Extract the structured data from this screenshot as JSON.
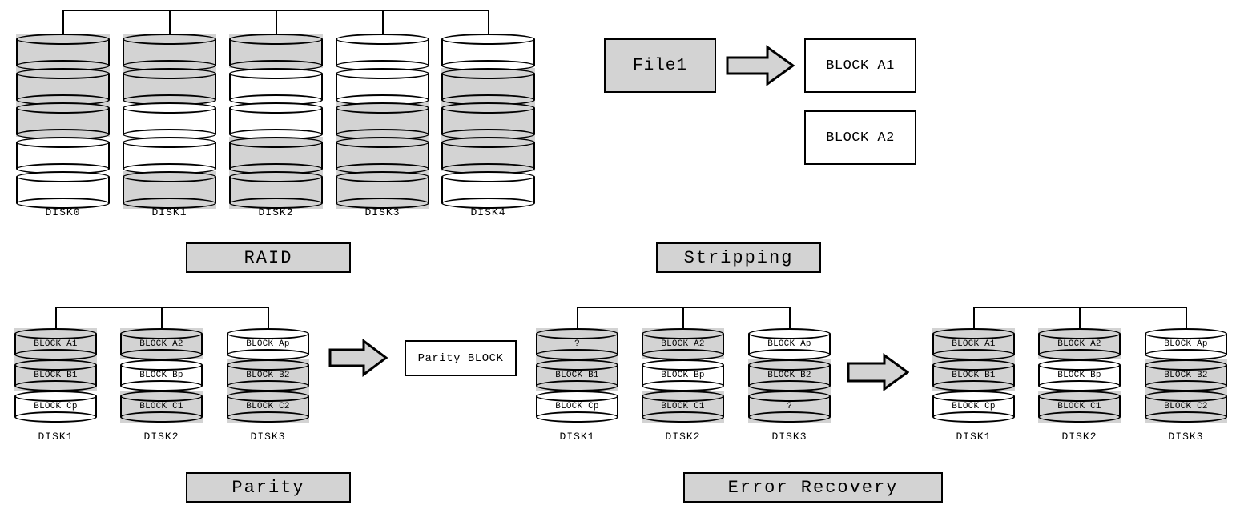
{
  "sections": {
    "raid": {
      "title": "RAID",
      "disks": [
        {
          "caption": "DISK0",
          "platters": [
            "gray",
            "gray",
            "gray",
            "white",
            "white"
          ]
        },
        {
          "caption": "DISK1",
          "platters": [
            "gray",
            "gray",
            "white",
            "white",
            "gray"
          ]
        },
        {
          "caption": "DISK2",
          "platters": [
            "gray",
            "white",
            "white",
            "gray",
            "gray"
          ]
        },
        {
          "caption": "DISK3",
          "platters": [
            "white",
            "white",
            "gray",
            "gray",
            "gray"
          ]
        },
        {
          "caption": "DISK4",
          "platters": [
            "white",
            "gray",
            "gray",
            "gray",
            "white"
          ]
        }
      ]
    },
    "stripping": {
      "title": "Stripping",
      "file_label": "File1",
      "blocks": [
        "BLOCK A1",
        "BLOCK A2"
      ]
    },
    "parity": {
      "title": "Parity",
      "disks": [
        {
          "caption": "DISK1",
          "blocks": [
            {
              "label": "BLOCK A1",
              "fill": "gray"
            },
            {
              "label": "BLOCK B1",
              "fill": "gray"
            },
            {
              "label": "BLOCK Cp",
              "fill": "white"
            }
          ]
        },
        {
          "caption": "DISK2",
          "blocks": [
            {
              "label": "BLOCK A2",
              "fill": "gray"
            },
            {
              "label": "BLOCK Bp",
              "fill": "white"
            },
            {
              "label": "BLOCK C1",
              "fill": "gray"
            }
          ]
        },
        {
          "caption": "DISK3",
          "blocks": [
            {
              "label": "BLOCK Ap",
              "fill": "white"
            },
            {
              "label": "BLOCK B2",
              "fill": "gray"
            },
            {
              "label": "BLOCK C2",
              "fill": "gray"
            }
          ]
        }
      ],
      "result_box": "Parity BLOCK"
    },
    "error_recovery": {
      "title": "Error Recovery",
      "before": [
        {
          "caption": "DISK1",
          "blocks": [
            {
              "label": "?",
              "fill": "gray"
            },
            {
              "label": "BLOCK B1",
              "fill": "gray"
            },
            {
              "label": "BLOCK Cp",
              "fill": "white"
            }
          ]
        },
        {
          "caption": "DISK2",
          "blocks": [
            {
              "label": "BLOCK A2",
              "fill": "gray"
            },
            {
              "label": "BLOCK Bp",
              "fill": "white"
            },
            {
              "label": "BLOCK C1",
              "fill": "gray"
            }
          ]
        },
        {
          "caption": "DISK3",
          "blocks": [
            {
              "label": "BLOCK Ap",
              "fill": "white"
            },
            {
              "label": "BLOCK B2",
              "fill": "gray"
            },
            {
              "label": "?",
              "fill": "gray"
            }
          ]
        }
      ],
      "after": [
        {
          "caption": "DISK1",
          "blocks": [
            {
              "label": "BLOCK A1",
              "fill": "gray"
            },
            {
              "label": "BLOCK B1",
              "fill": "gray"
            },
            {
              "label": "BLOCK Cp",
              "fill": "white"
            }
          ]
        },
        {
          "caption": "DISK2",
          "blocks": [
            {
              "label": "BLOCK A2",
              "fill": "gray"
            },
            {
              "label": "BLOCK Bp",
              "fill": "white"
            },
            {
              "label": "BLOCK C1",
              "fill": "gray"
            }
          ]
        },
        {
          "caption": "DISK3",
          "blocks": [
            {
              "label": "BLOCK Ap",
              "fill": "white"
            },
            {
              "label": "BLOCK B2",
              "fill": "gray"
            },
            {
              "label": "BLOCK C2",
              "fill": "gray"
            }
          ]
        }
      ]
    }
  },
  "colors": {
    "fill_gray": "#d3d3d3",
    "fill_white": "#ffffff",
    "stroke": "#000000"
  }
}
